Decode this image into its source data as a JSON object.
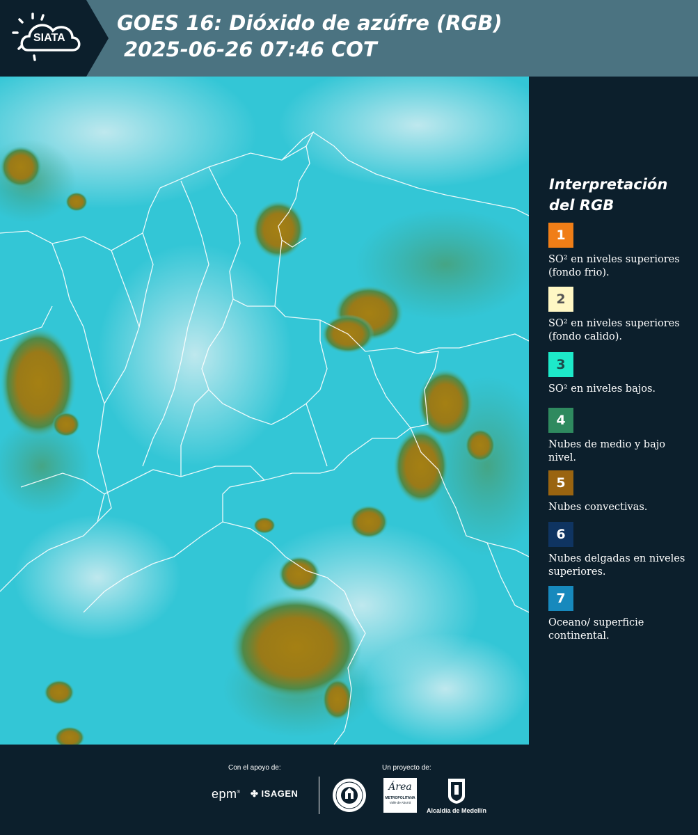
{
  "header": {
    "brand": "SIATA",
    "title_line1": "GOES 16: Dióxido de azúfre (RGB)",
    "title_line2": "2025-06-26 07:46 COT",
    "background_color": "#4b7381",
    "logo_background_color": "#0c1f2c"
  },
  "map": {
    "product": "SO2 RGB satellite composite",
    "icon": "satellite-imagery"
  },
  "legend": {
    "title_line1": "Interpretación",
    "title_line2": "del RGB",
    "items": [
      {
        "number": "1",
        "label": "SO² en niveles superiores (fondo frio).",
        "color": "#f07e17",
        "text_color": "#ffffff"
      },
      {
        "number": "2",
        "label": "SO² en niveles superiores (fondo calido).",
        "color": "#fff7c4",
        "text_color": "#555555"
      },
      {
        "number": "3",
        "label": "SO² en niveles bajos.",
        "color": "#1de9c9",
        "text_color": "#1d4a4a"
      },
      {
        "number": "4",
        "label": "Nubes de medio y bajo nivel.",
        "color": "#2f8a5f",
        "text_color": "#ffffff"
      },
      {
        "number": "5",
        "label": "Nubes convectivas.",
        "color": "#9a6410",
        "text_color": "#ffffff"
      },
      {
        "number": "6",
        "label": "Nubes delgadas en niveles superiores.",
        "color": "#0f3461",
        "text_color": "#ffffff"
      },
      {
        "number": "7",
        "label": "Oceano/ superficie continental.",
        "color": "#1789bd",
        "text_color": "#ffffff"
      }
    ]
  },
  "footer": {
    "support_label": "Con el apoyo de:",
    "project_label": "Un proyecto de:",
    "sponsor_epm": "epm",
    "sponsor_isagen": "ISAGEN",
    "area_metro_name": "Área",
    "area_metro_sub": "METROPOLITANA",
    "area_metro_sub2": "Valle de Aburrá",
    "alcaldia": "Alcaldía de Medellín"
  }
}
